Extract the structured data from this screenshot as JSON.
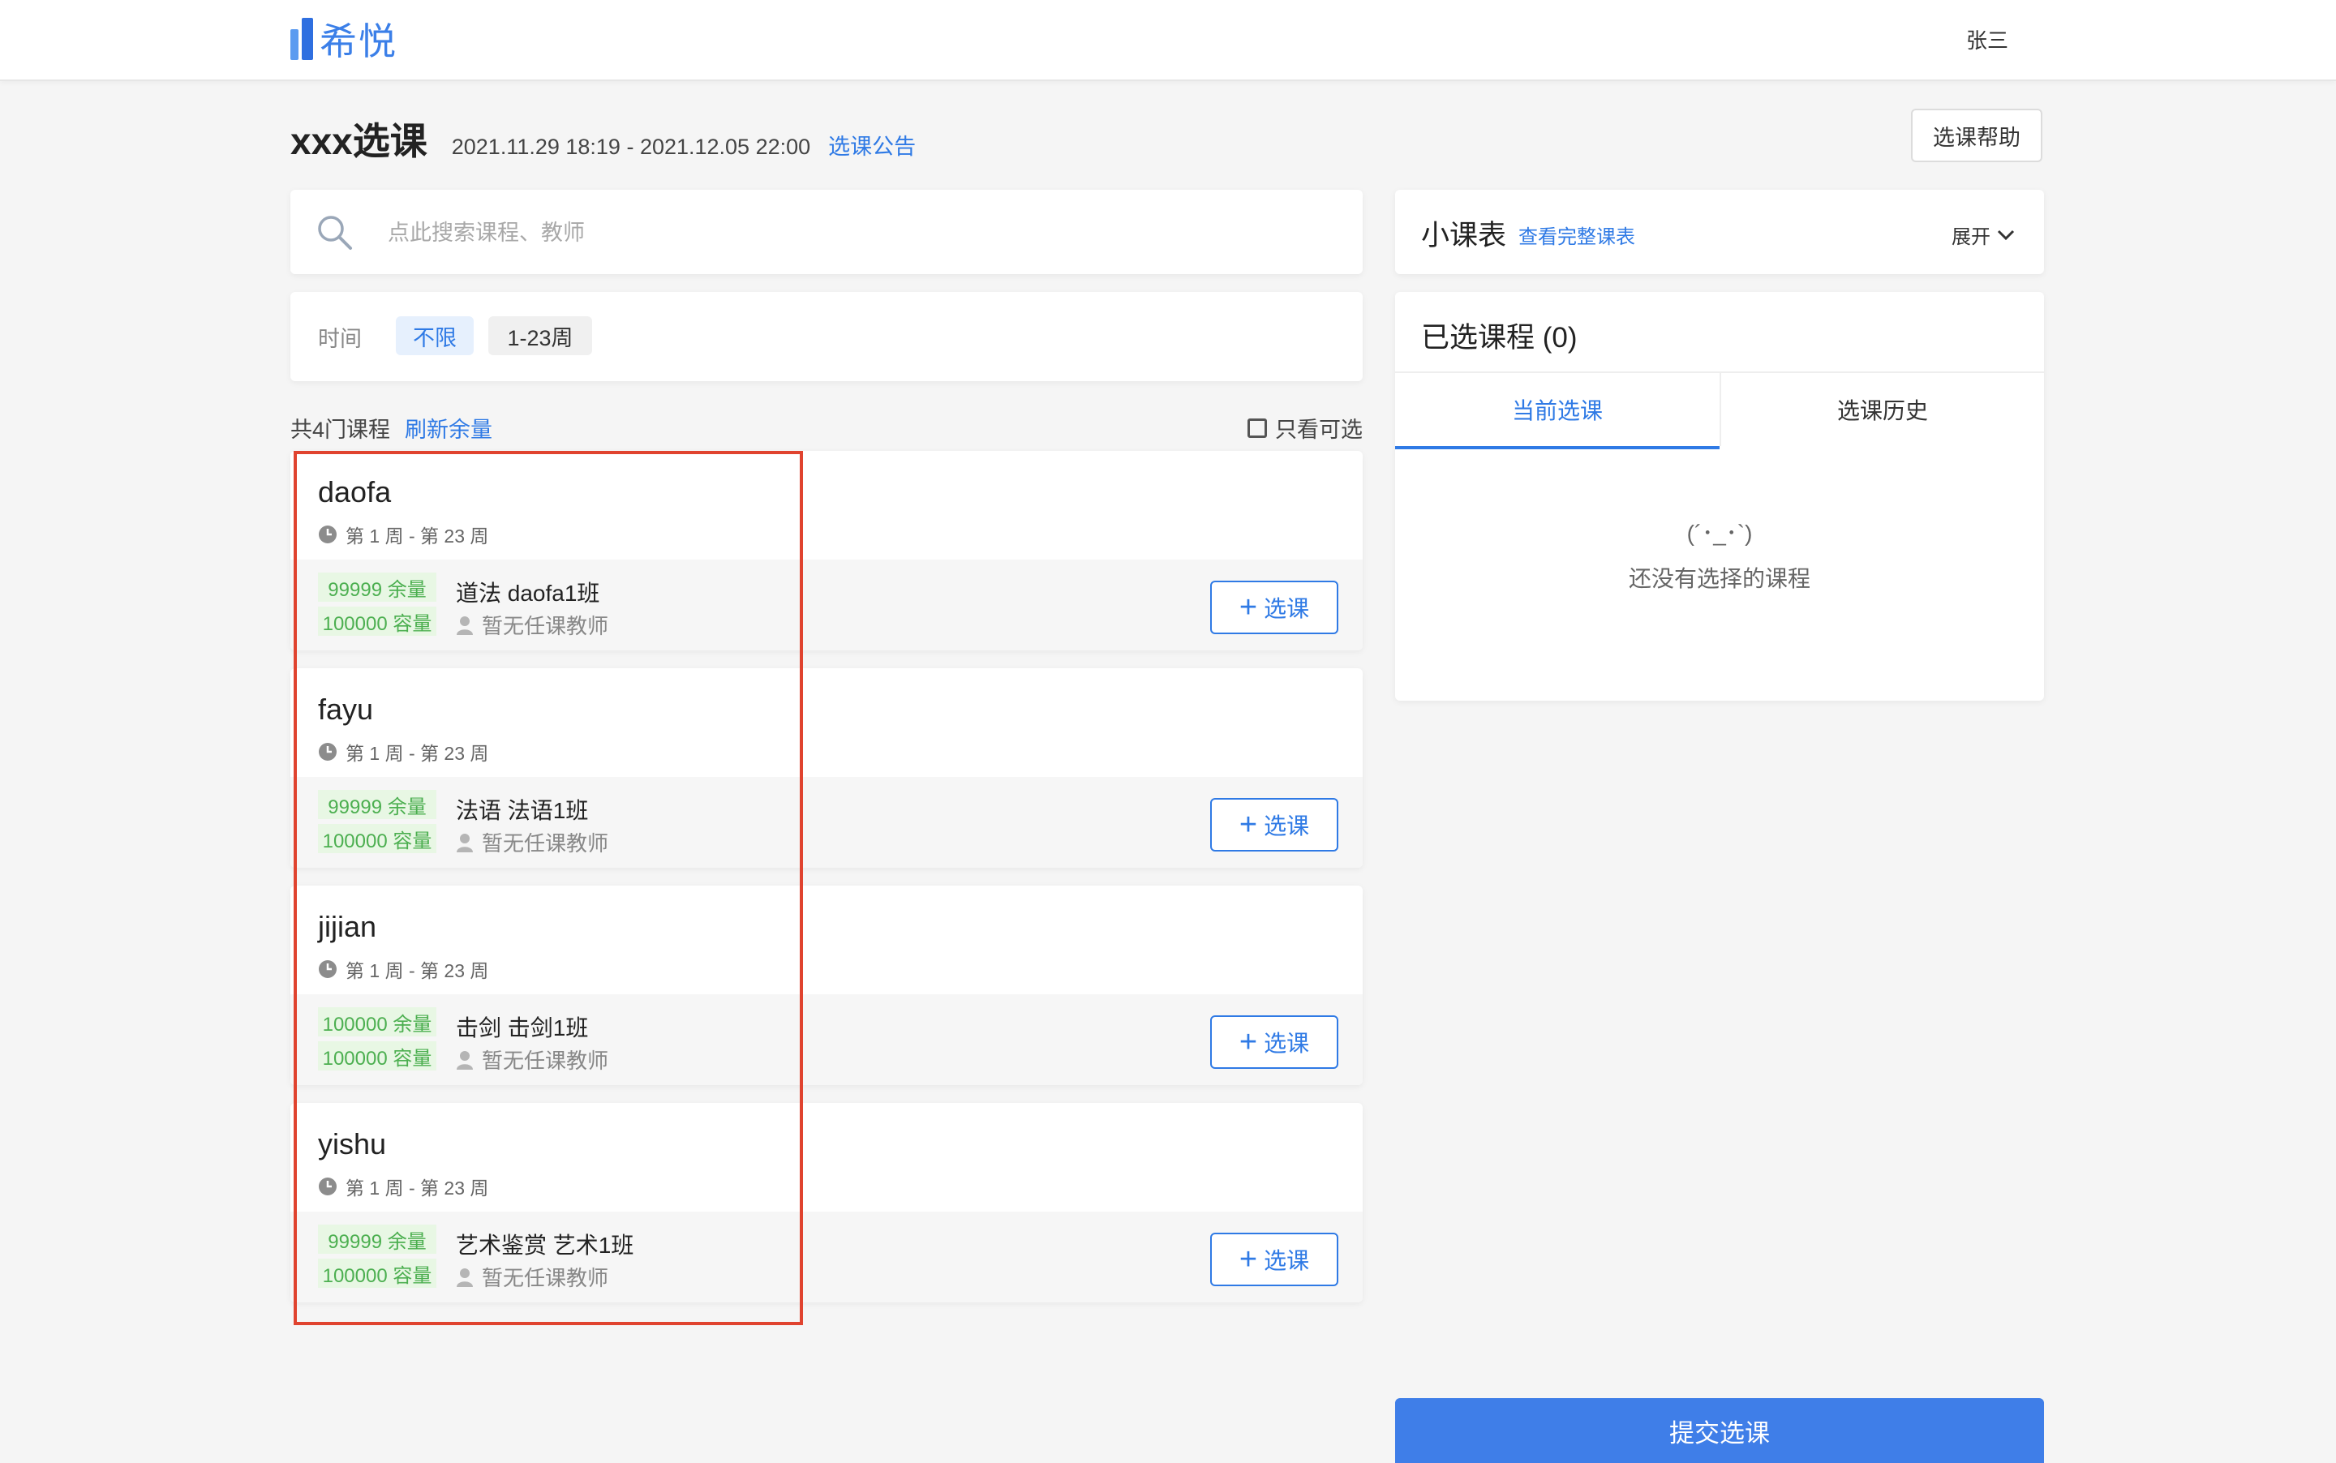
{
  "header": {
    "logo_text": "希悦",
    "user_name": "张三"
  },
  "page": {
    "title": "xxx选课",
    "period": "2021.11.29 18:19 - 2021.12.05 22:00",
    "notice_link": "选课公告",
    "help_button": "选课帮助"
  },
  "search": {
    "placeholder": "点此搜索课程、教师"
  },
  "filter": {
    "label": "时间",
    "options": [
      {
        "label": "不限",
        "active": true
      },
      {
        "label": "1-23周",
        "active": false
      }
    ]
  },
  "list": {
    "count_text": "共4门课程",
    "refresh_link": "刷新余量",
    "only_selectable": "只看可选"
  },
  "courses": [
    {
      "name": "daofa",
      "weeks": "第 1 周 - 第 23 周",
      "remain": "99999 余量",
      "capacity": "100000 容量",
      "class_name": "道法 daofa1班",
      "teacher": "暂无任课教师",
      "button": "选课"
    },
    {
      "name": "fayu",
      "weeks": "第 1 周 - 第 23 周",
      "remain": "99999 余量",
      "capacity": "100000 容量",
      "class_name": "法语 法语1班",
      "teacher": "暂无任课教师",
      "button": "选课"
    },
    {
      "name": "jijian",
      "weeks": "第 1 周 - 第 23 周",
      "remain": "100000 余量",
      "capacity": "100000 容量",
      "class_name": "击剑 击剑1班",
      "teacher": "暂无任课教师",
      "button": "选课"
    },
    {
      "name": "yishu",
      "weeks": "第 1 周 - 第 23 周",
      "remain": "99999 余量",
      "capacity": "100000 容量",
      "class_name": "艺术鉴赏 艺术1班",
      "teacher": "暂无任课教师",
      "button": "选课"
    }
  ],
  "mini_schedule": {
    "title": "小课表",
    "link": "查看完整课表",
    "expand": "展开"
  },
  "selected": {
    "title": "已选课程 (0)",
    "tabs": [
      {
        "label": "当前选课",
        "active": true
      },
      {
        "label": "选课历史",
        "active": false
      }
    ],
    "empty_face": "(´･_･`)",
    "empty_text": "还没有选择的课程"
  },
  "submit_button": "提交选课",
  "colors": {
    "accent": "#2f7ae5",
    "badge_bg": "#e8f7e4",
    "badge_text": "#4caf50",
    "highlight_border": "#e0432f",
    "submit_bg": "#3f7ee8"
  }
}
